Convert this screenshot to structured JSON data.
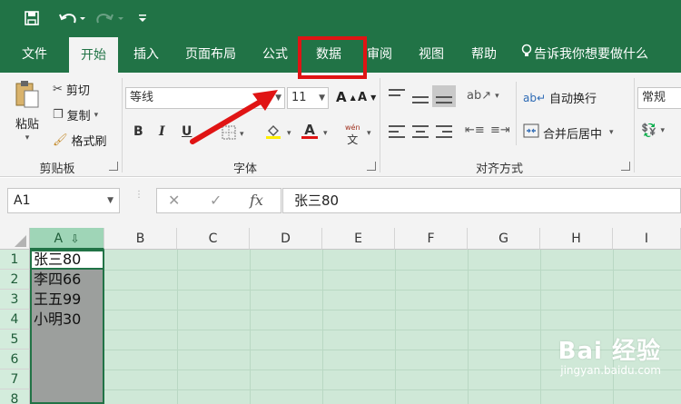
{
  "quick_access": {
    "save_icon": "save-icon",
    "undo_icon": "undo-icon",
    "redo_icon": "redo-icon",
    "customize_icon": "customize-icon"
  },
  "tabs": [
    {
      "label": "文件"
    },
    {
      "label": "开始"
    },
    {
      "label": "插入"
    },
    {
      "label": "页面布局"
    },
    {
      "label": "公式"
    },
    {
      "label": "数据"
    },
    {
      "label": "审阅"
    },
    {
      "label": "视图"
    },
    {
      "label": "帮助"
    },
    {
      "label": "告诉我你想要做什么"
    }
  ],
  "ribbon": {
    "clipboard": {
      "paste_label": "粘贴",
      "cut_label": "剪切",
      "copy_label": "复制",
      "format_painter_label": "格式刷",
      "group_label": "剪贴板"
    },
    "font": {
      "font_name": "等线",
      "font_size": "11",
      "grow_label": "A",
      "shrink_label": "A",
      "bold": "B",
      "italic": "I",
      "underline": "U",
      "font_color_letter": "A",
      "phonetic_label": "wén",
      "group_label": "字体"
    },
    "alignment": {
      "wrap_text_label": "自动换行",
      "merge_center_label": "合并后居中",
      "group_label": "对齐方式"
    },
    "number": {
      "format_value": "常规"
    }
  },
  "formula_bar": {
    "name_box": "A1",
    "cancel": "✕",
    "enter": "✓",
    "fx": "fx",
    "formula": "张三80"
  },
  "grid": {
    "columns": [
      "A",
      "B",
      "C",
      "D",
      "E",
      "F",
      "G",
      "H",
      "I"
    ],
    "rows": [
      "1",
      "2",
      "3",
      "4",
      "5",
      "6",
      "7",
      "8"
    ],
    "cells": [
      "张三80",
      "李四66",
      "王五99",
      "小明30"
    ]
  },
  "watermark": {
    "main": "Bai 经验",
    "sub": "jingyan.baidu.com"
  },
  "colors": {
    "excel_green": "#217346",
    "annotation_red": "#e01414",
    "selection_gray": "#9c9f9d",
    "selection_tint": "#cfe8d7"
  }
}
